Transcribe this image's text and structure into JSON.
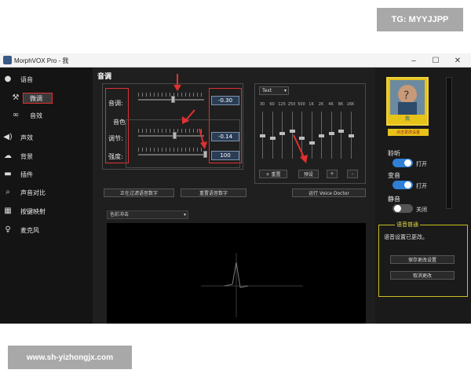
{
  "watermarks": {
    "top_right": "TG: MYYJJPP",
    "bottom_left": "www.sh-yizhongjx.com"
  },
  "window": {
    "title": "MorphVOX Pro - 我",
    "minimize": "–",
    "maximize": "☐",
    "close": "✕"
  },
  "sidebar": {
    "items": [
      {
        "label": "语音",
        "icon": "speaker-icon"
      },
      {
        "label": "微调",
        "icon": "tools-icon",
        "selected": true
      },
      {
        "label": "音效",
        "icon": "effects-icon"
      },
      {
        "label": "声效",
        "icon": "volume-icon"
      },
      {
        "label": "背景",
        "icon": "cloud-icon"
      },
      {
        "label": "插件",
        "icon": "plugin-icon"
      },
      {
        "label": "声音对比",
        "icon": "search-icon"
      },
      {
        "label": "按键映射",
        "icon": "keyboard-icon"
      },
      {
        "label": "麦克风",
        "icon": "microphone-icon"
      }
    ]
  },
  "main": {
    "title": "音调",
    "pitch": {
      "label": "音调:",
      "value": "-0.30"
    },
    "timbre_group": "音色",
    "adjust": {
      "label": "调节:",
      "value": "-0.14"
    },
    "strength": {
      "label": "强度:",
      "value": "100"
    },
    "eq": {
      "preset": "Text",
      "bands": [
        "30",
        "60",
        "125",
        "250",
        "500",
        "1K",
        "2K",
        "4K",
        "8K",
        "16K"
      ],
      "band_levels": [
        0.5,
        0.45,
        0.55,
        0.6,
        0.45,
        0.35,
        0.5,
        0.55,
        0.6,
        0.5
      ],
      "add_label": "+ 重置",
      "preset_button": "预设",
      "plus": "+",
      "minus": "-"
    },
    "buttons": {
      "alter_voice": "正在过滤语音数字",
      "reset_voice": "重置语音数字",
      "voice_doctor": "运行 Voice Doctor"
    },
    "mode_select": "色彩冲击"
  },
  "right": {
    "avatar_caption": "我",
    "avatar_button": "点击更改设置",
    "listen": {
      "label": "聆听",
      "state": "打开",
      "on": true
    },
    "morph": {
      "label": "变音",
      "state": "打开",
      "on": true
    },
    "mute": {
      "label": "静音",
      "state": "关闭",
      "on": false
    },
    "notice": {
      "title": "语音普通",
      "text": "语音设置已更改。",
      "save": "保存更改设置",
      "cancel": "取消更改"
    }
  },
  "colors": {
    "accent_blue": "#2f7fd6",
    "highlight_red": "#e03030",
    "notice_yellow": "#c8c020"
  }
}
